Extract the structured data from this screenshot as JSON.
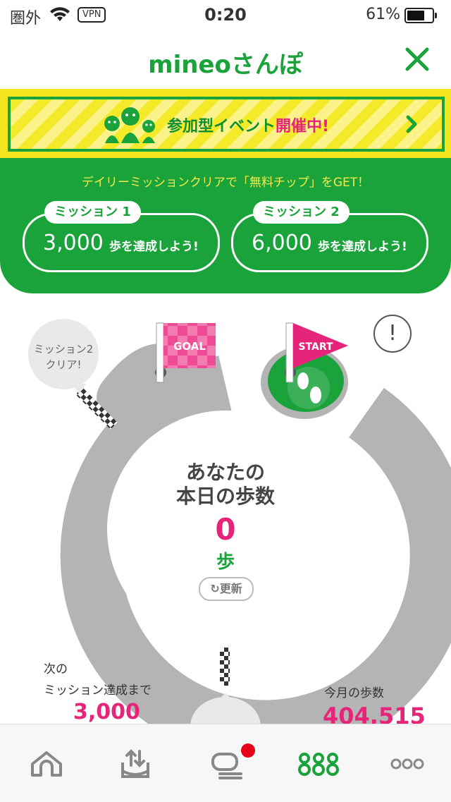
{
  "status_bar": {
    "carrier": "圏外",
    "vpn": "VPN",
    "time": "0:20",
    "battery_percent": "61%",
    "battery_level": 0.61
  },
  "header": {
    "title": "mineoさんぽ",
    "close_icon": "close-icon"
  },
  "event_banner": {
    "label_prefix": "参加型イベント",
    "label_highlight": "開催中!",
    "colors": {
      "background": "#f4e61e",
      "border": "#1aa33b",
      "text": "#0f8f2f",
      "highlight": "#e6257a"
    }
  },
  "missions": {
    "notice": "デイリーミッションクリアで「無料チップ」をGET！",
    "items": [
      {
        "tag": "ミッション 1",
        "value": "3,000",
        "unit": "歩を達成しよう!"
      },
      {
        "tag": "ミッション 2",
        "value": "6,000",
        "unit": "歩を達成しよう!"
      }
    ]
  },
  "track": {
    "goal_label": "GOAL",
    "start_label": "START",
    "bubble": "ミッション2\nクリア!",
    "info": "!"
  },
  "today": {
    "label_line1": "あなたの",
    "label_line2": "本日の歩数",
    "steps": "0",
    "unit": "歩",
    "refresh": "更新"
  },
  "next_mission": {
    "label_line1": "次の",
    "label_line2": "ミッション達成まで",
    "value": "3,000"
  },
  "this_month": {
    "label": "今月の歩数",
    "value": "404,515"
  },
  "tabbar": {
    "items": [
      {
        "icon": "home-icon"
      },
      {
        "icon": "upload-tray-icon"
      },
      {
        "icon": "chat-icon",
        "badge": true
      },
      {
        "icon": "walk-dots-icon",
        "active": true
      },
      {
        "icon": "more-icon"
      }
    ]
  },
  "colors": {
    "green": "#1aa33b",
    "pink": "#e6257a",
    "track_gray": "#b4b4b4"
  }
}
